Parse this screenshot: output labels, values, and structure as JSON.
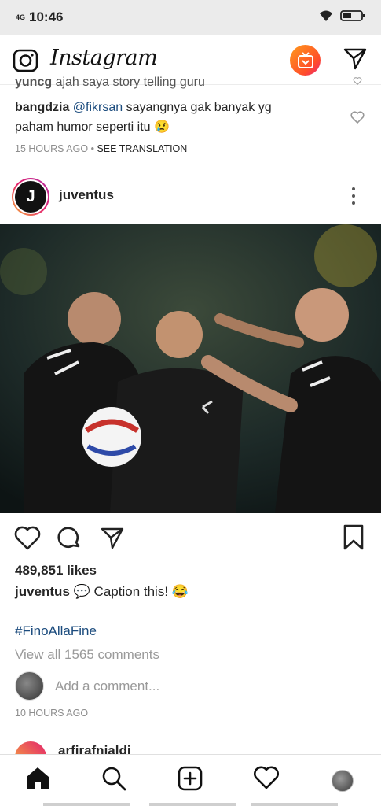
{
  "status_bar": {
    "network": "4G",
    "time": "10:46"
  },
  "app": {
    "title": "Instagram"
  },
  "comments": [
    {
      "user": "yuncg",
      "text": "ajah saya story telling guru"
    },
    {
      "user": "bangdzia",
      "mention": "@fikrsan",
      "text_line1": "sayangnya gak banyak yg",
      "text_line2": "paham humor seperti itu",
      "emoji": "😢"
    }
  ],
  "comment_meta": {
    "time": "15 HOURS AGO",
    "separator": "•",
    "translation": "SEE TRANSLATION"
  },
  "post": {
    "username": "juventus",
    "avatar_letter": "J",
    "likes": "489,851 likes",
    "caption_user": "juventus",
    "caption_emoji_1": "💬",
    "caption_text": "Caption this!",
    "caption_emoji_2": "😂",
    "hashtag": "#FinoAllaFine",
    "view_all": "View all 1565 comments",
    "add_comment_placeholder": "Add a comment...",
    "time": "10 HOURS AGO"
  },
  "next_post": {
    "username": "arfirafnialdi"
  },
  "colors": {
    "link": "#1c4c7e",
    "muted": "#8e8e8e",
    "text": "#262626"
  }
}
